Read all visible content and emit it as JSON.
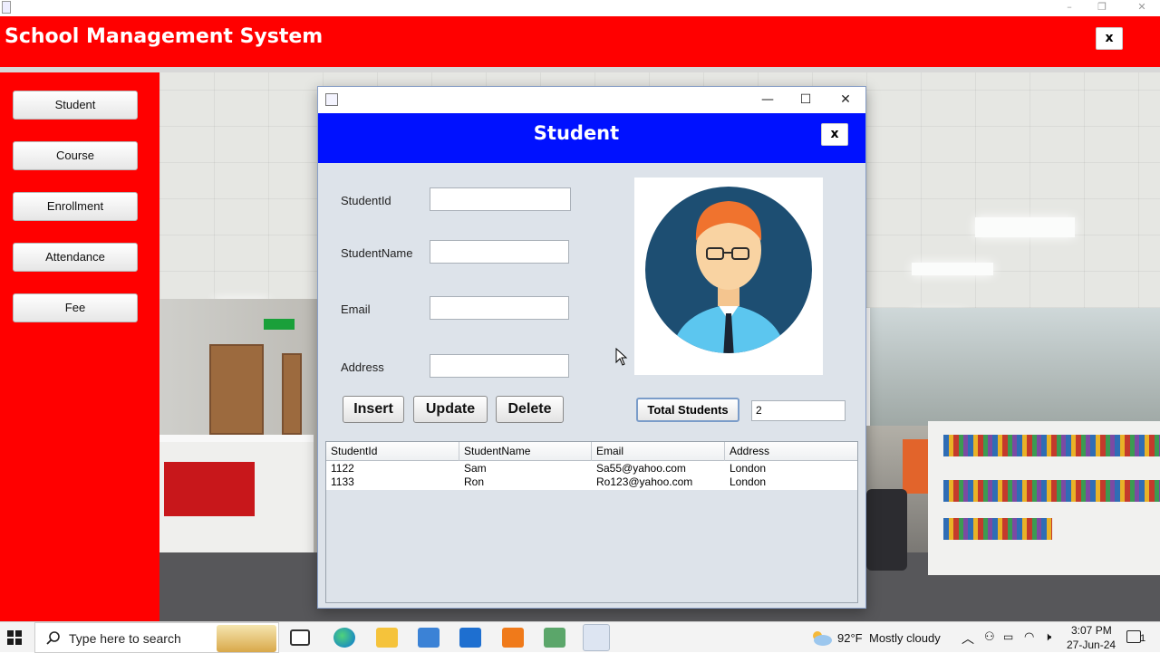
{
  "app": {
    "title": "School Management System",
    "close_label": "x"
  },
  "outer_window_controls": {
    "minimize": "–",
    "restore": "❐",
    "close": "✕"
  },
  "sidebar": {
    "items": [
      {
        "label": "Student"
      },
      {
        "label": "Course"
      },
      {
        "label": "Enrollment"
      },
      {
        "label": "Attendance"
      },
      {
        "label": "Fee"
      }
    ]
  },
  "dialog": {
    "controls": {
      "minimize": "—",
      "maximize": "☐",
      "close": "✕"
    },
    "title": "Student",
    "close_label": "x",
    "fields": {
      "student_id": {
        "label": "StudentId",
        "value": ""
      },
      "student_name": {
        "label": "StudentName",
        "value": ""
      },
      "email": {
        "label": "Email",
        "value": ""
      },
      "address": {
        "label": "Address",
        "value": ""
      }
    },
    "buttons": {
      "insert": "Insert",
      "update": "Update",
      "delete": "Delete"
    },
    "total": {
      "button_label": "Total Students",
      "value": "2"
    },
    "table": {
      "columns": [
        "StudentId",
        "StudentName",
        "Email",
        "Address"
      ],
      "rows": [
        [
          "1122",
          "Sam",
          "Sa55@yahoo.com",
          "London"
        ],
        [
          "1133",
          "Ron",
          "Ro123@yahoo.com",
          "London"
        ]
      ]
    }
  },
  "taskbar": {
    "search_placeholder": "Type here to search",
    "weather": {
      "temp": "92°F",
      "condition": "Mostly cloudy"
    },
    "time": "3:07 PM",
    "date": "27-Jun-24",
    "notification_count": "1"
  },
  "colors": {
    "header_red": "#ff0000",
    "dialog_header_blue": "#0011ff"
  }
}
